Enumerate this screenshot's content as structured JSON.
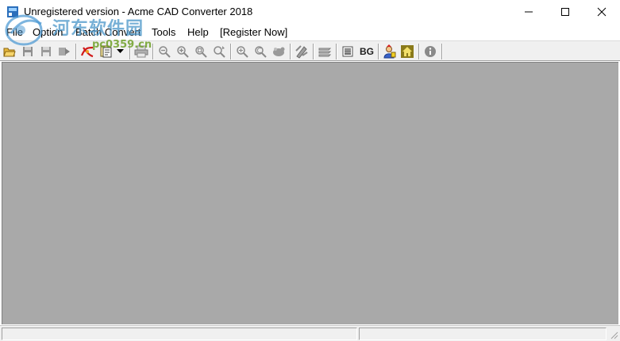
{
  "window": {
    "title": "Unregistered version - Acme CAD Converter 2018",
    "minimize_glyph": "—",
    "maximize_glyph": "☐",
    "close_glyph": "✕"
  },
  "watermark": {
    "cn_text": "河东软件园",
    "url_text": "pc0359.cn"
  },
  "menu": {
    "items": [
      {
        "label": "File"
      },
      {
        "label": "Option"
      },
      {
        "label": "Batch Convert"
      },
      {
        "label": "Tools"
      },
      {
        "label": "Help"
      },
      {
        "label": "[Register Now]"
      }
    ]
  },
  "toolbar": {
    "bg_label": "BG",
    "icons": [
      "open-icon",
      "save-icon",
      "save-as-icon",
      "export-icon",
      "pdf-convert-icon",
      "batch-convert-icon",
      "dropdown-arrow-icon",
      "print-icon",
      "zoom-out-icon",
      "zoom-in-icon",
      "zoom-window-icon",
      "zoom-realtime-icon",
      "zoom-all-icon",
      "zoom-previous-icon",
      "pan-icon",
      "pen-icon",
      "layers-icon",
      "black-white-icon",
      "background-icon",
      "wizard-icon",
      "home-icon",
      "about-icon"
    ]
  },
  "colors": {
    "canvas_bg": "#a9a9a9",
    "toolbar_bg": "#f0f0f0",
    "watermark_blue": "#4a96c8",
    "watermark_green": "#6ea028"
  }
}
